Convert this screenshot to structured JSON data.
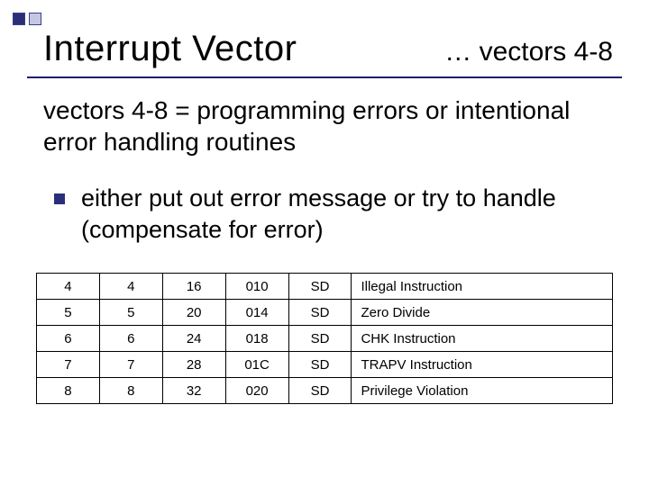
{
  "header": {
    "title": "Interrupt Vector",
    "subtitle_right": "… vectors 4-8"
  },
  "body": {
    "intro": "vectors 4-8 = programming errors or intentional error handling routines",
    "bullet": "either put out error message or try to handle (compensate for error)"
  },
  "chart_data": {
    "type": "table",
    "columns": [
      "vec_dec",
      "vec_num",
      "offset_dec",
      "offset_hex",
      "space",
      "description"
    ],
    "rows": [
      {
        "vec_dec": "4",
        "vec_num": "4",
        "offset_dec": "16",
        "offset_hex": "010",
        "space": "SD",
        "description": "Illegal Instruction"
      },
      {
        "vec_dec": "5",
        "vec_num": "5",
        "offset_dec": "20",
        "offset_hex": "014",
        "space": "SD",
        "description": "Zero Divide"
      },
      {
        "vec_dec": "6",
        "vec_num": "6",
        "offset_dec": "24",
        "offset_hex": "018",
        "space": "SD",
        "description": "CHK Instruction"
      },
      {
        "vec_dec": "7",
        "vec_num": "7",
        "offset_dec": "28",
        "offset_hex": "01C",
        "space": "SD",
        "description": "TRAPV Instruction"
      },
      {
        "vec_dec": "8",
        "vec_num": "8",
        "offset_dec": "32",
        "offset_hex": "020",
        "space": "SD",
        "description": "Privilege Violation"
      }
    ]
  }
}
